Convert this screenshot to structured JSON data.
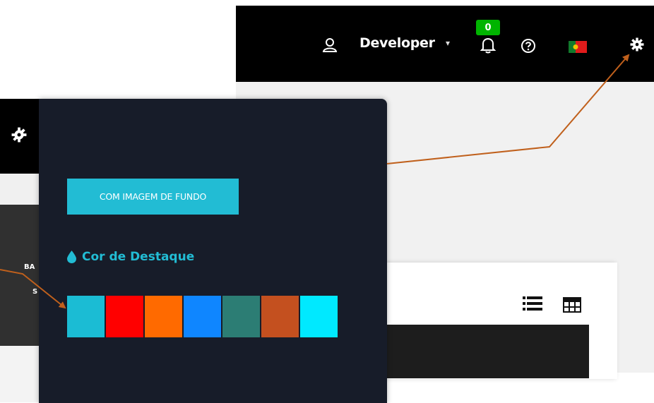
{
  "topbar": {
    "user_name": "Developer",
    "caret": "▾",
    "notifications_count": "0",
    "icons": [
      "user-icon",
      "bell-icon",
      "help-icon",
      "flag-icon",
      "gear-icon"
    ]
  },
  "settings": {
    "bg_image_button_label": "COM IMAGEM DE FUNDO",
    "accent_title": "Cor de Destaque",
    "accent_colors": [
      "#1bbcd4",
      "#ff0000",
      "#ff6a00",
      "#0f86ff",
      "#2c7d74",
      "#c4501f",
      "#00e9ff"
    ]
  },
  "left_fragment": {
    "text_ba": "BA",
    "text_s": "S"
  },
  "colors": {
    "accent": "#22bcd4",
    "panel_bg": "#171c29",
    "annotation_arrow": "#c0601c"
  }
}
